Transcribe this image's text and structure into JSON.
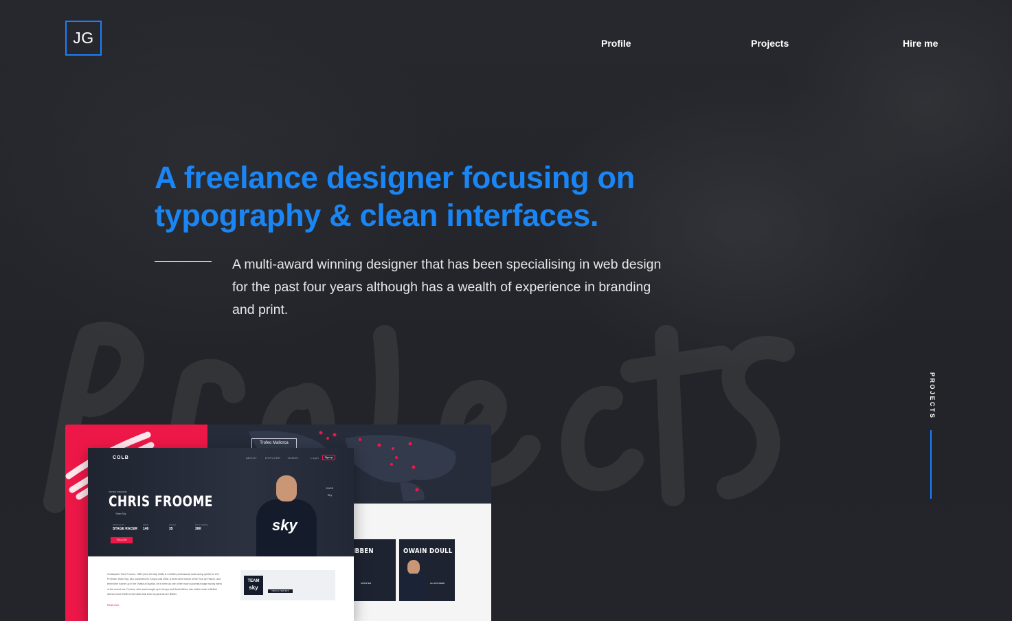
{
  "brand": {
    "logo_text": "JG"
  },
  "nav": {
    "items": [
      {
        "label": "Profile"
      },
      {
        "label": "Projects"
      },
      {
        "label": "Hire me"
      }
    ]
  },
  "hero": {
    "headline_line1": "A freelance designer focusing on",
    "headline_line2": "typography & clean interfaces.",
    "intro": "A multi-award winning designer that has been specialising in web design for the past four years although has a wealth of experience in branding and print."
  },
  "side": {
    "label": "PROJECTS"
  },
  "colors": {
    "accent": "#1a86f5",
    "background": "#24262c",
    "preview_accent": "#ee1848"
  },
  "project_preview": {
    "site_logo": "COLB",
    "site_nav": [
      "ABOUT",
      "EXPLORE",
      "TEAMS",
      "Login"
    ],
    "site_signup": "Sign up",
    "map_label": "Trofeo Mallorca",
    "kicker": "UNITED KINGDOM",
    "rider_name": "CHRIS FROOME",
    "team_tag": "Team Sky",
    "stats": [
      {
        "label": "SPECIALITY",
        "value": "STAGE RACER"
      },
      {
        "label": "WINS",
        "value": "146"
      },
      {
        "label": "RACES",
        "value": "35"
      },
      {
        "label": "FOLLOWERS",
        "value": "36K"
      }
    ],
    "follow_label": "FOLLOW",
    "jersey_text": "sky",
    "sponsors": [
      "KASK",
      "Sky"
    ],
    "bio": "Christopher Clive Froome, OBE (born 20 May 1985) is a British professional road racing cyclist for UCI ProTeam Team Sky, who competed for Kenya until 2008. A three-time winner of the Tour de France, and three-time runner up in the Vuelta a España, he is seen as one of the most successful stage racing riders of the recent era. Froome, who was brought up in Kenya and South Africa, has ridden under a British licence since 2008 on the basis that both his parents are British.",
    "read_more": "Read more",
    "team_card": {
      "logo_line1": "TEAM",
      "logo_line2": "sky",
      "cta": "VIEW ALL TEAM INFO"
    },
    "cards": [
      {
        "name": "I DIBBEN",
        "role": "SPRINTER"
      },
      {
        "name": "OWAIN DOULL",
        "role": "ALL ROUNDER"
      }
    ]
  }
}
